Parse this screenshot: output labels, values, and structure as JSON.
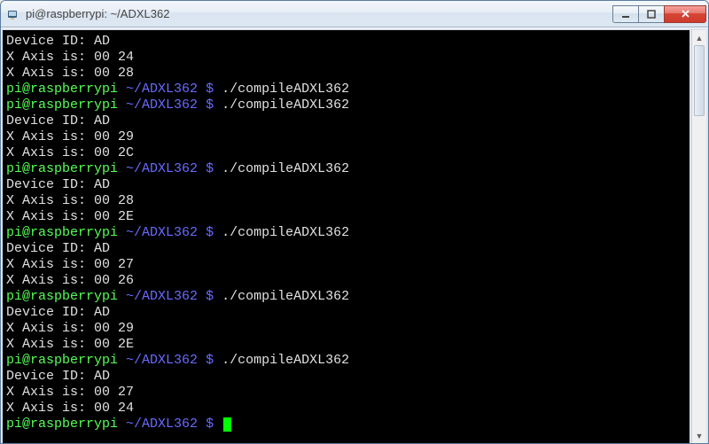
{
  "title": "pi@raspberrypi: ~/ADXL362",
  "prompt": {
    "user": "pi@raspberrypi",
    "path": "~/ADXL362",
    "dollar": "$"
  },
  "command": "./compileADXL362",
  "runs": [
    {
      "pre": true,
      "device_id": "AD",
      "x1": "00 24",
      "x2": "00 28"
    },
    {
      "device_id": "AD",
      "x1": "00 29",
      "x2": "00 2C"
    },
    {
      "device_id": "AD",
      "x1": "00 28",
      "x2": "00 2E"
    },
    {
      "device_id": "AD",
      "x1": "00 27",
      "x2": "00 26"
    },
    {
      "device_id": "AD",
      "x1": "00 29",
      "x2": "00 2E"
    },
    {
      "device_id": "AD",
      "x1": "00 27",
      "x2": "00 24"
    }
  ],
  "labels": {
    "device_id": "Device ID:",
    "x_axis": "X Axis is:"
  }
}
